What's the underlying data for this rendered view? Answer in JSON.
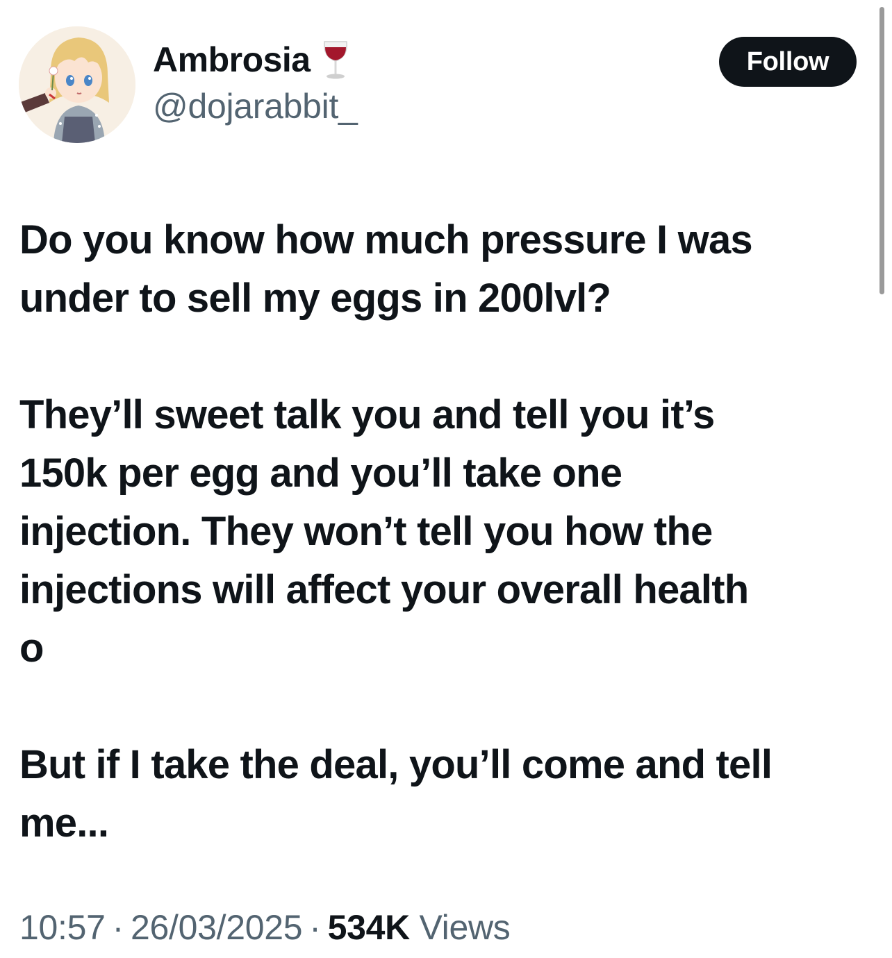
{
  "profile": {
    "display_name": "Ambrosia",
    "name_emoji": "wine-glass-icon",
    "handle": "@dojarabbit_",
    "avatar": "avatar-anime-girl"
  },
  "follow_label": "Follow",
  "tweet": {
    "paragraphs": [
      [
        "Do you know how much pressure I was",
        "under to sell my eggs in 200lvl?"
      ],
      [
        "They’ll sweet talk you and tell you it’s",
        "150k per egg and you’ll take one",
        "injection. They won’t tell you how the",
        "injections will affect your overall health",
        "o"
      ],
      [
        "But if I take the deal, you’ll come and tell",
        "me..."
      ]
    ]
  },
  "meta": {
    "time": "10:57",
    "separator": "·",
    "date": "26/03/2025",
    "views_count": "534K",
    "views_label": "Views"
  },
  "colors": {
    "text": "#0f1419",
    "secondary": "#536471",
    "button_bg": "#0f1419",
    "button_text": "#ffffff"
  }
}
